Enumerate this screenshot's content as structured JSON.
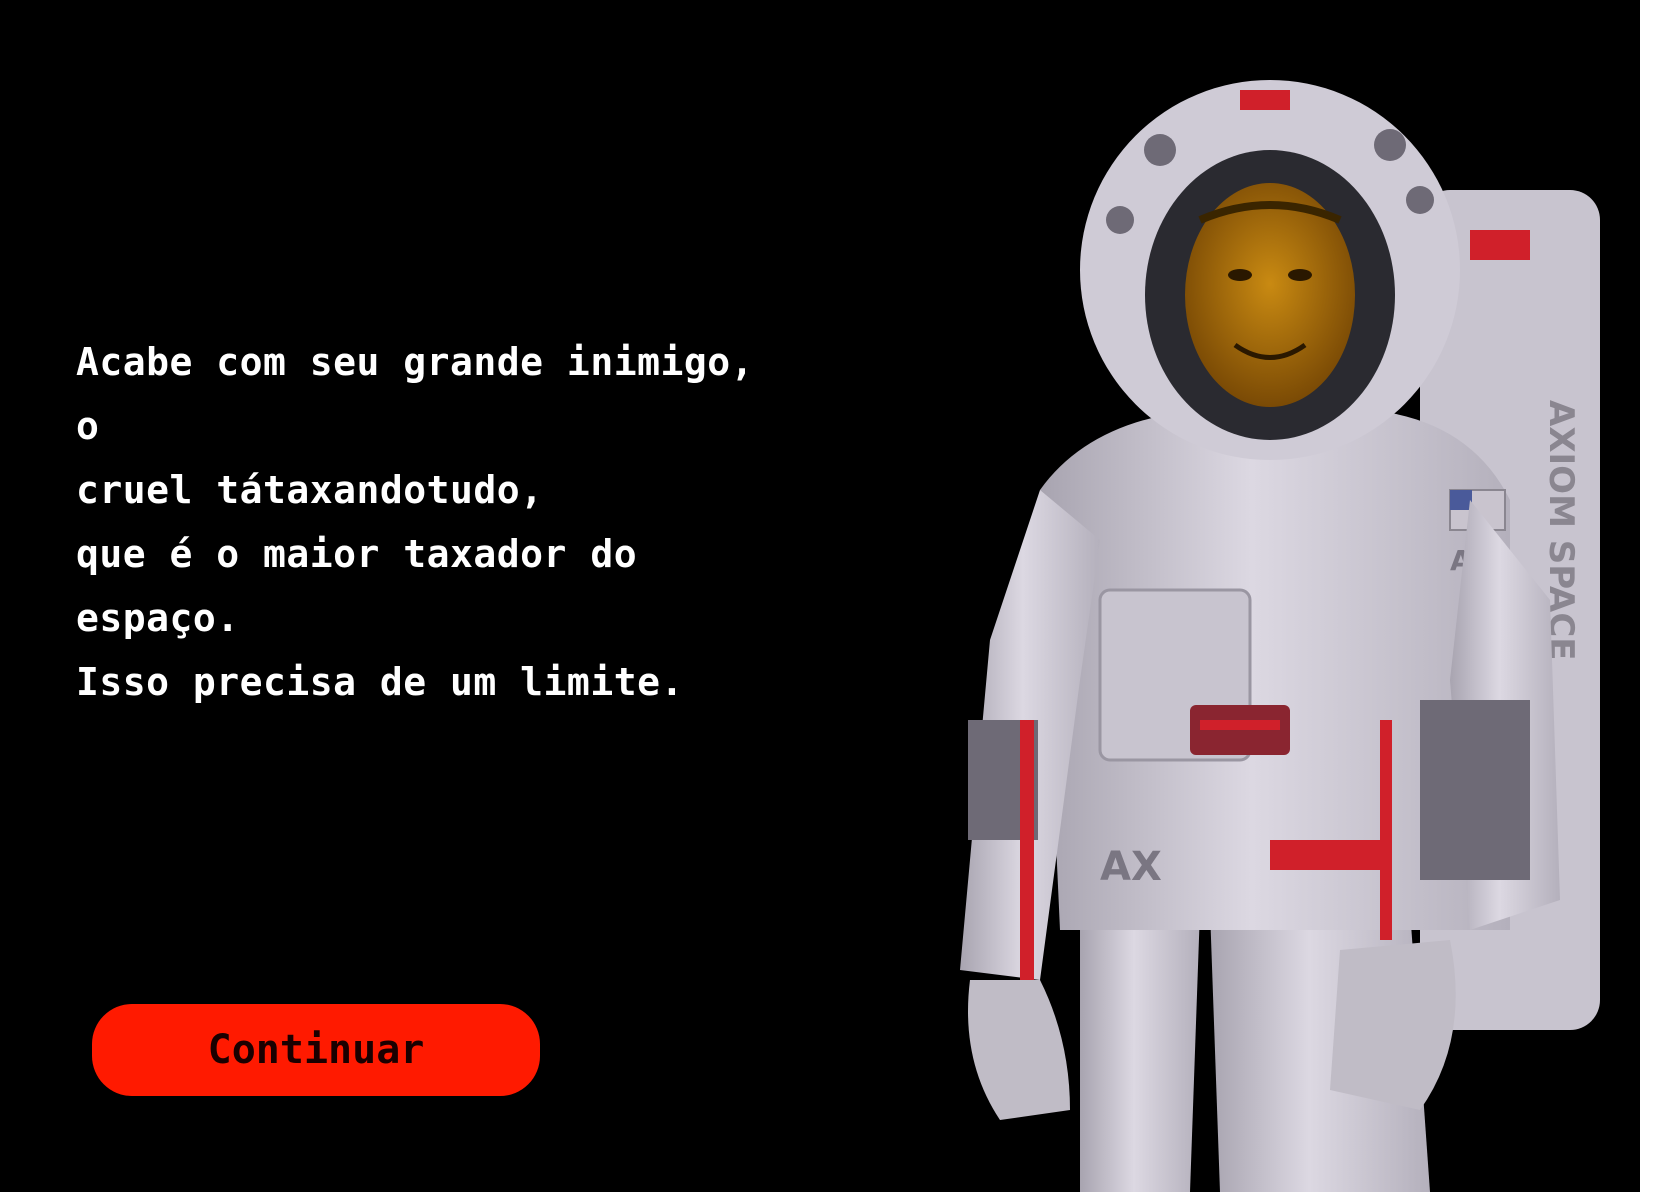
{
  "story": {
    "lines": [
      "Acabe com seu grande inimigo, o",
      "cruel tátaxandotudo,",
      "que é o maior taxador do",
      "espaço.",
      "Isso precisa de um limite."
    ]
  },
  "button": {
    "continue_label": "Continuar"
  },
  "character": {
    "icon": "astronaut-character",
    "suit_brand": "AXIOM SPACE",
    "patch_label": "AX"
  },
  "colors": {
    "background": "#000000",
    "text": "#ffffff",
    "button": "#ff1a00",
    "suit": "#d8d4de",
    "stripe": "#d0202a"
  }
}
